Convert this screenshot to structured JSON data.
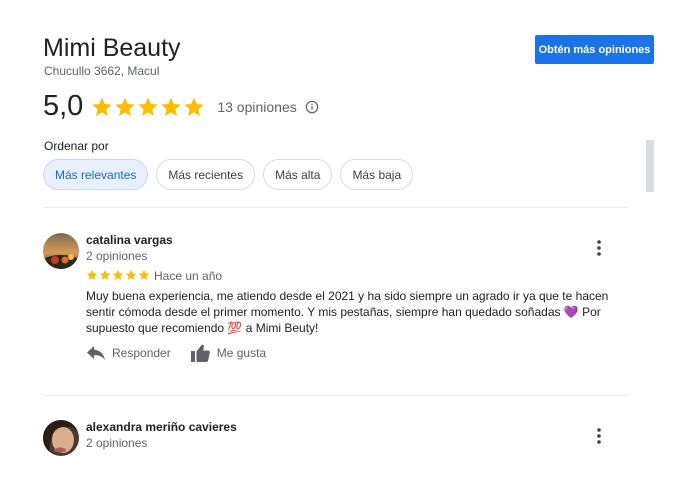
{
  "business": {
    "name": "Mimi Beauty",
    "address": "Chucullo 3662, Macul",
    "cta_label": "Obtén más opiniones"
  },
  "rating": {
    "value": "5,0",
    "stars": 5,
    "count_label": "13 opiniones"
  },
  "sort": {
    "label": "Ordenar por",
    "options": [
      "Más relevantes",
      "Más recientes",
      "Más alta",
      "Más baja"
    ],
    "selected": "Más relevantes"
  },
  "colors": {
    "accent": "#1a73e8",
    "star": "#fbbc04",
    "chip_active_bg": "#e8f0fe"
  },
  "reviews": [
    {
      "name": "catalina vargas",
      "reviews_count": "2 opiniones",
      "stars": 5,
      "time": "Hace un año",
      "text": "Muy buena experiencia, me atiendo desde el 2021 y ha sido siempre un agrado ir ya que te hacen sentir cómoda desde el primer momento. Y mis pestañas, siempre han quedado soñadas 💜 Por supuesto que recomiendo 💯 a Mimi Beuty!",
      "reply_label": "Responder",
      "like_label": "Me gusta"
    },
    {
      "name": "alexandra meriño cavieres",
      "reviews_count": "2 opiniones"
    }
  ]
}
